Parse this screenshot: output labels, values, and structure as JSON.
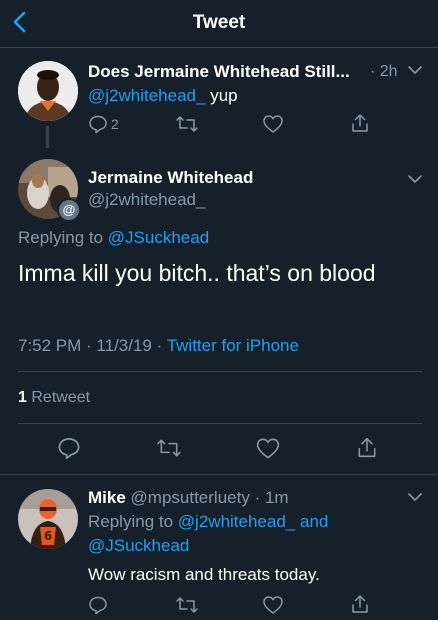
{
  "header": {
    "title": "Tweet"
  },
  "parent_tweet": {
    "name": "Does Jermaine Whitehead Still...",
    "time": "· 2h",
    "handle": "@j2whitehead_",
    "text": "yup",
    "reply_count": "2"
  },
  "main_tweet": {
    "name": "Jermaine Whitehead",
    "handle": "@j2whitehead_",
    "replying_prefix": "Replying to",
    "replying_handle": "@JSuckhead",
    "text": "Imma kill you bitch.. that’s on blood",
    "timestamp": "7:52 PM · 11/3/19 ·",
    "source": "Twitter for iPhone",
    "retweet_count": "1",
    "retweet_label": "Retweet",
    "avatar_badge": "@"
  },
  "reply_tweet": {
    "name": "Mike",
    "handle": "@mpsutterluety",
    "time": "· 1m",
    "replying_prefix": "Replying to",
    "replying_handle_1": "@j2whitehead_",
    "replying_and": "and",
    "replying_handle_2": "@JSuckhead",
    "text": "Wow racism and threats today."
  },
  "colors": {
    "background": "#15202b",
    "accent": "#1da1f2",
    "secondary_text": "#8899a6",
    "divider": "#38444d"
  }
}
